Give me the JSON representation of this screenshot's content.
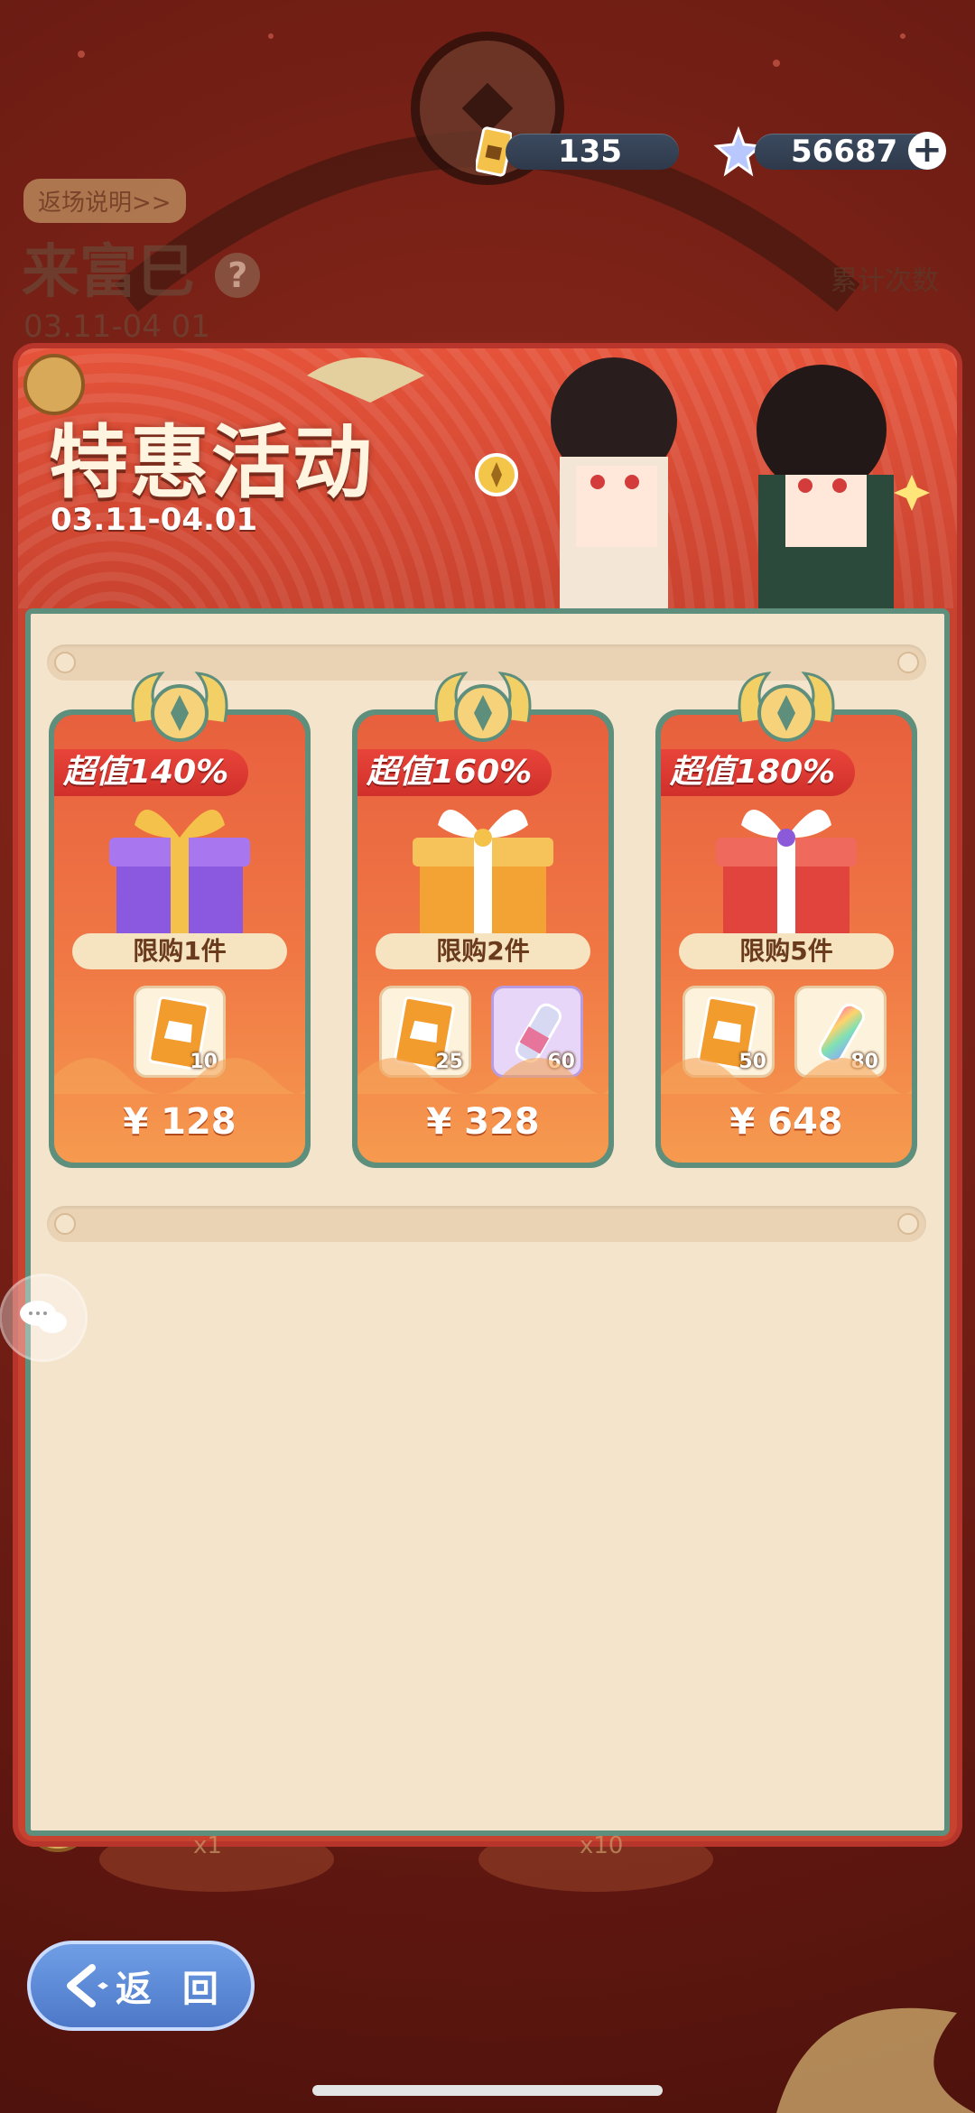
{
  "currency": {
    "tickets": "135",
    "stars": "56687",
    "add": "+"
  },
  "background_event": {
    "explain_link": "返场说明>>",
    "title": "来富巳",
    "help": "?",
    "date": "03.11-04 01",
    "cumulative_label": "累计次数",
    "x1": "x1",
    "x10": "x10"
  },
  "banner": {
    "title": "特惠活动",
    "date": "03.11-04.01"
  },
  "offers": [
    {
      "value": "超值140%",
      "limit": "限购1件",
      "items": [
        {
          "icon": "outfit-card-icon",
          "qty": "10"
        }
      ],
      "price": "¥ 128",
      "box_color": "#8b58e0"
    },
    {
      "value": "超值160%",
      "limit": "限购2件",
      "items": [
        {
          "icon": "outfit-card-icon",
          "qty": "25"
        },
        {
          "icon": "paint-tube-icon",
          "qty": "60"
        }
      ],
      "price": "¥ 328",
      "box_color": "#f2a334"
    },
    {
      "value": "超值180%",
      "limit": "限购5件",
      "items": [
        {
          "icon": "outfit-card-icon",
          "qty": "50"
        },
        {
          "icon": "rainbow-paint-tube-icon",
          "qty": "80"
        }
      ],
      "price": "¥ 648",
      "box_color": "#e0443c"
    }
  ],
  "back_button": {
    "label": "返 回"
  },
  "colors": {
    "panel_red": "#c8432f",
    "cream": "#f5e4cc",
    "teal_border": "#5e8f7c",
    "card_orange": "#f07845"
  }
}
